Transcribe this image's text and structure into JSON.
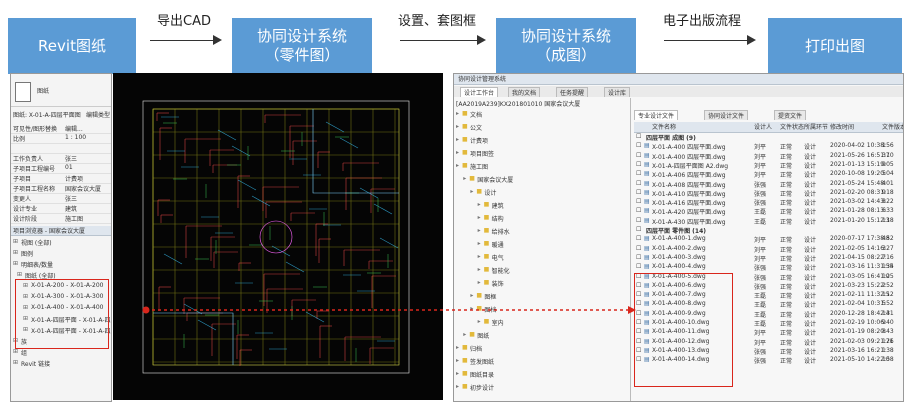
{
  "flow": {
    "steps": [
      {
        "line1": "Revit图纸",
        "line2": ""
      },
      {
        "line1": "协同设计系统",
        "line2": "（零件图）"
      },
      {
        "line1": "协同设计系统",
        "line2": "（成图）"
      },
      {
        "line1": "打印出图",
        "line2": ""
      }
    ],
    "arrows": [
      "导出CAD",
      "设置、套图框",
      "电子出版流程"
    ]
  },
  "revit": {
    "type_label": "图纸",
    "sheet_name": "图纸: X-01-A-四层平面图",
    "edit_type": "编辑类型",
    "props": [
      [
        "可见性/图形替换",
        "编辑..."
      ],
      [
        "比例",
        "1 : 100"
      ],
      [
        "",
        ""
      ],
      [
        "工作负责人",
        "张三"
      ],
      [
        "子项目工程编号",
        "01"
      ],
      [
        "子项目",
        "计费项"
      ],
      [
        "子项目工程名称",
        "国家会议大厦"
      ],
      [
        "变更人",
        "张三"
      ],
      [
        "设计专业",
        "建筑"
      ],
      [
        "设计阶段",
        "施工图"
      ]
    ],
    "browser_title": "项目浏览器 - 国家会议大厦",
    "tree": [
      "视图 (全部)",
      "图例",
      "明细表/数量",
      "图纸 (全部)",
      "X-01-A-200 - X-01-A-200",
      "X-01-A-300 - X-01-A-300",
      "X-01-A-400 - X-01-A-400",
      "X-01-A-四层平面 - X-01-A-四层",
      "X-01-A-四层平面 - X-01-A-四层",
      "族",
      "组",
      "Revit 链接"
    ]
  },
  "system": {
    "title": "协同设计管理系统",
    "tabs": [
      "设计工作台",
      "我的文档",
      "任务提醒",
      "设计库"
    ],
    "project": "[AA2019A239]KX201801010 国家会议大厦",
    "tree": [
      "文档",
      "公文",
      "计费项",
      "项目图签",
      "施工图",
      "国家会议大厦",
      "设计",
      "建筑",
      "结构",
      "给排水",
      "暖通",
      "电气",
      "智能化",
      "装饰",
      "图框",
      "图档",
      "室内",
      "图纸",
      "归档",
      "签发图纸",
      "图纸目录",
      "初步设计"
    ],
    "file_tabs": [
      "专业设计文件",
      "协同设计文件",
      "提资文件"
    ],
    "columns": [
      "文件名称",
      "设计人",
      "文件状态",
      "所属环节",
      "修改时间",
      "文件版本"
    ],
    "group_1": "四层平面 成图 (9)",
    "group_2": "四层平面 零件图 (14)",
    "files_1": [
      [
        "X-01-A-400 四层平面.dwg",
        "刘平",
        "正常",
        "设计",
        "2020-04-02 10:38:56",
        "1"
      ],
      [
        "X-01-A-400 四层平面.dwg",
        "刘平",
        "正常",
        "设计",
        "2021-05-26 16:51:10",
        "37"
      ],
      [
        "X-01-A-四层平面图 A2.dwg",
        "刘平",
        "正常",
        "设计",
        "2021-01-13 15:19:05",
        "9"
      ],
      [
        "X-01-A-406 四层平面.dwg",
        "刘平",
        "正常",
        "设计",
        "2020-10-08 19:20:04",
        "5"
      ],
      [
        "X-01-A-408 四层平面.dwg",
        "张强",
        "正常",
        "设计",
        "2021-05-24 15:48:01",
        "4"
      ],
      [
        "X-01-A-410 四层平面.dwg",
        "张强",
        "正常",
        "设计",
        "2021-02-20 08:31:18",
        "9"
      ],
      [
        "X-01-A-416 四层平面.dwg",
        "张强",
        "正常",
        "设计",
        "2021-03-02 14:43:22",
        "8"
      ],
      [
        "X-01-A-420 四层平面.dwg",
        "王磊",
        "正常",
        "设计",
        "2021-01-28 08:13:33",
        "6"
      ],
      [
        "X-01-A-430 四层平面.dwg",
        "王磊",
        "正常",
        "设计",
        "2021-01-20 15:12:18",
        "13"
      ]
    ],
    "files_2": [
      [
        "X-01-A-400-1.dwg",
        "刘平",
        "正常",
        "设计",
        "2020-07-17 17:38:52",
        "48"
      ],
      [
        "X-01-A-400-2.dwg",
        "刘平",
        "正常",
        "设计",
        "2021-02-05 14:16:27",
        "3"
      ],
      [
        "X-01-A-400-3.dwg",
        "刘平",
        "正常",
        "设计",
        "2021-04-15 08:22:16",
        "7"
      ],
      [
        "X-01-A-400-4.dwg",
        "张强",
        "正常",
        "设计",
        "2021-03-16 11:31:34",
        "155"
      ],
      [
        "X-01-A-400-5.dwg",
        "张强",
        "正常",
        "设计",
        "2021-03-05 16:41:25",
        "10"
      ],
      [
        "X-01-A-400-6.dwg",
        "张强",
        "正常",
        "设计",
        "2021-03-23 15:22:52",
        "2"
      ],
      [
        "X-01-A-400-7.dwg",
        "王磊",
        "正常",
        "设计",
        "2021-02-11 11:32:12",
        "15"
      ],
      [
        "X-01-A-400-8.dwg",
        "王磊",
        "正常",
        "设计",
        "2021-02-04 10:31:52",
        "5"
      ],
      [
        "X-01-A-400-9.dwg",
        "王磊",
        "正常",
        "设计",
        "2020-12-28 18:42:31",
        "14"
      ],
      [
        "X-01-A-400-10.dwg",
        "王磊",
        "正常",
        "设计",
        "2021-02-19 10:06:40",
        "9"
      ],
      [
        "X-01-A-400-11.dwg",
        "刘平",
        "正常",
        "设计",
        "2021-01-19 08:20:43",
        "8"
      ],
      [
        "X-01-A-400-12.dwg",
        "刘平",
        "正常",
        "设计",
        "2021-02-03 09:21:26",
        "171"
      ],
      [
        "X-01-A-400-13.dwg",
        "张强",
        "正常",
        "设计",
        "2021-03-16 16:21:38",
        "1"
      ],
      [
        "X-01-A-400-14.dwg",
        "张强",
        "正常",
        "设计",
        "2021-05-10 14:22:58",
        "10"
      ]
    ]
  },
  "colors": {
    "step_fill": "#5b9bd5",
    "accent": "#d9261c",
    "cad_bg": "#050505"
  }
}
